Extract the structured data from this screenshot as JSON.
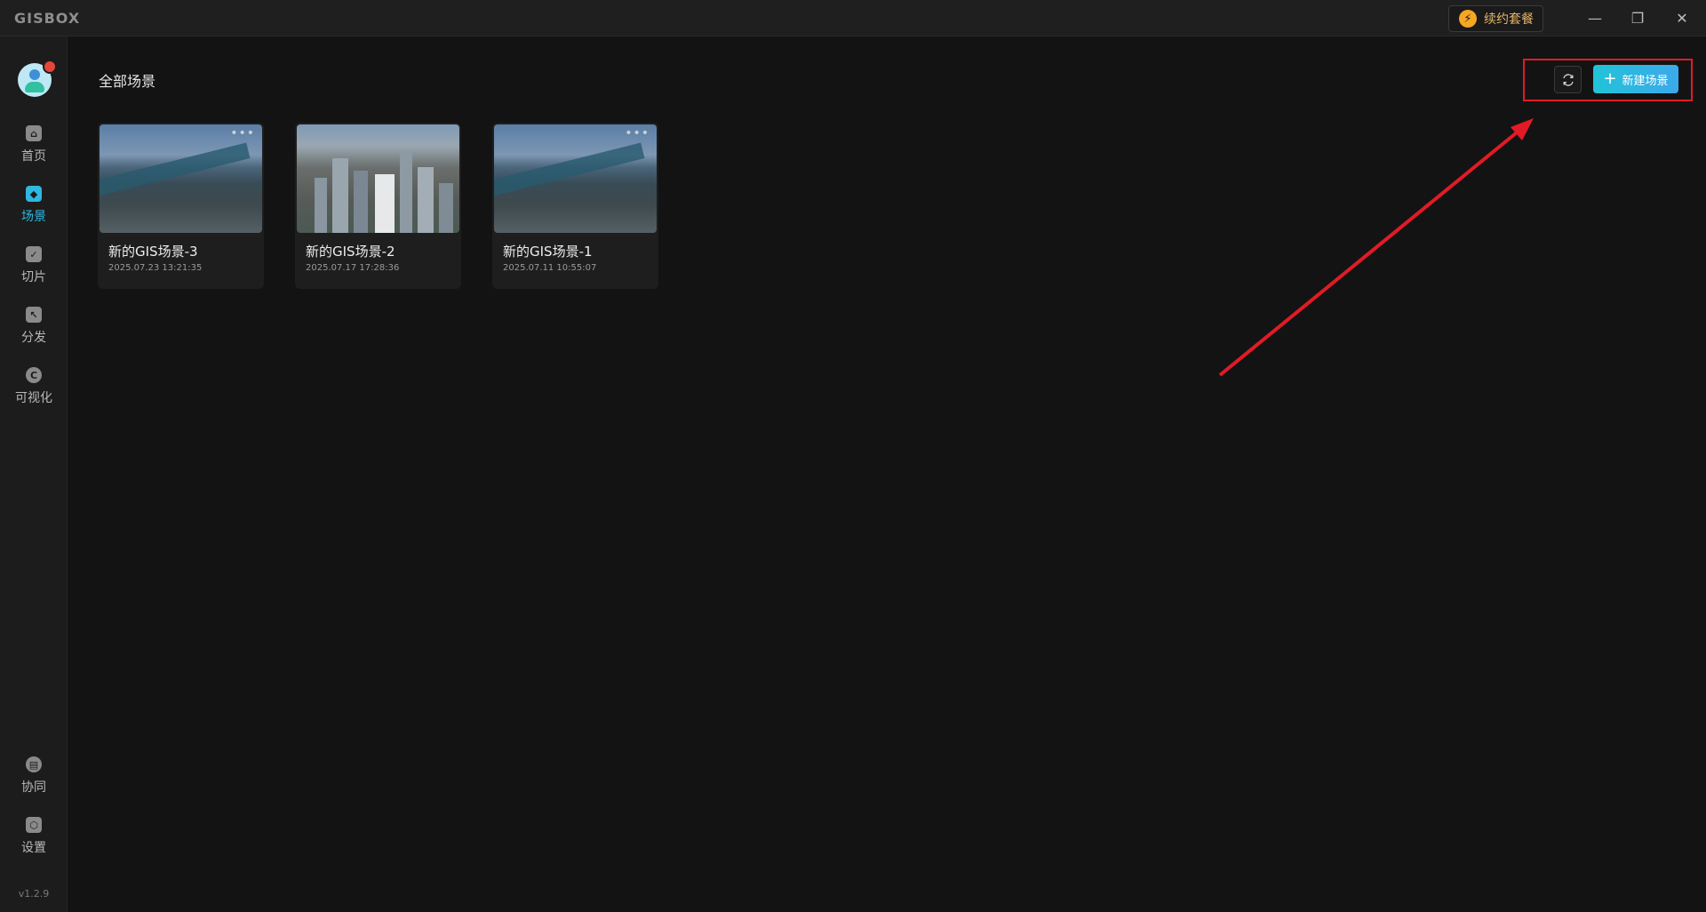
{
  "app": {
    "logo": "GISBOX",
    "renew_label": "续约套餐",
    "window_controls": {
      "minimize": "—",
      "restore": "❐",
      "close": "✕"
    }
  },
  "sidebar": {
    "items": [
      {
        "label": "首页",
        "icon": "home-icon",
        "active": false
      },
      {
        "label": "场景",
        "icon": "scene-icon",
        "active": true
      },
      {
        "label": "切片",
        "icon": "slice-icon",
        "active": false
      },
      {
        "label": "分发",
        "icon": "distribute-icon",
        "active": false
      },
      {
        "label": "可视化",
        "icon": "visualize-icon",
        "active": false
      }
    ],
    "bottom_items": [
      {
        "label": "协同",
        "icon": "collab-icon"
      },
      {
        "label": "设置",
        "icon": "settings-icon"
      }
    ],
    "version": "v1.2.9"
  },
  "main": {
    "title": "全部场景",
    "refresh_icon": "refresh-icon",
    "new_button_label": "新建场景",
    "scenes": [
      {
        "name": "新的GIS场景-3",
        "date": "2025.07.23 13:21:35"
      },
      {
        "name": "新的GIS场景-2",
        "date": "2025.07.17 17:28:36"
      },
      {
        "name": "新的GIS场景-1",
        "date": "2025.07.11 10:55:07"
      }
    ]
  },
  "colors": {
    "accent": "#2fb7e0",
    "annotation": "#e11b25",
    "background": "#131313",
    "sidebar": "#1c1c1c"
  }
}
